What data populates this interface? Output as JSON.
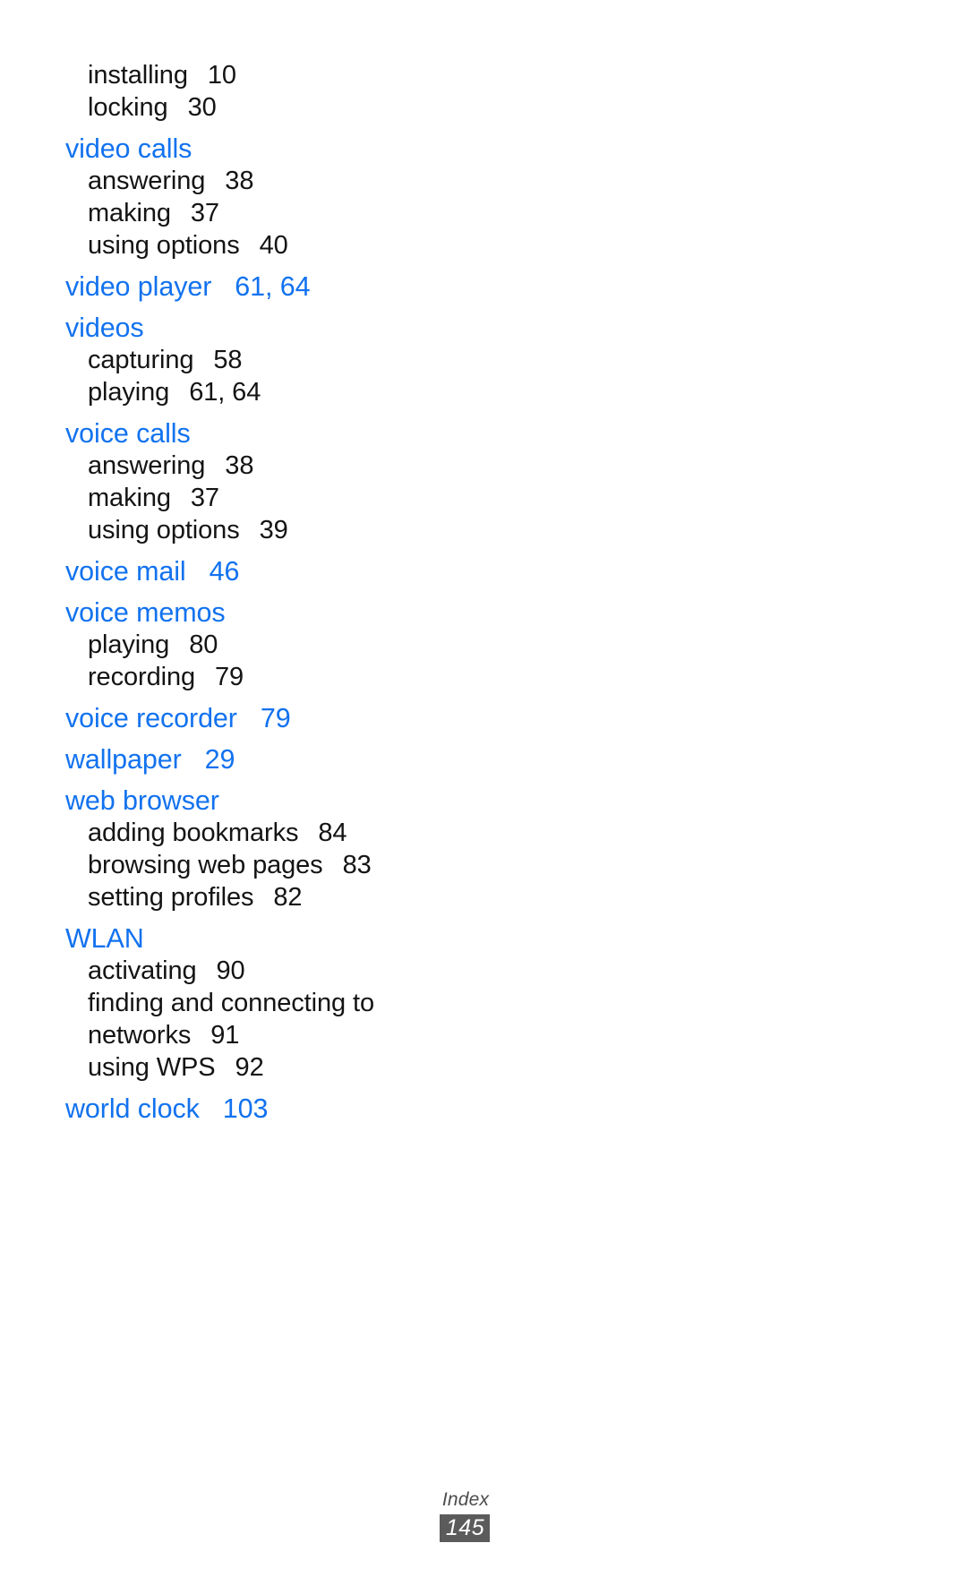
{
  "document": {
    "section_title": "Index",
    "page_number": "145",
    "heading_color": "#1272ef",
    "body_color": "#141414",
    "badge_background": "#5b5b5b",
    "badge_text_color": "#ffffff",
    "footer_label_color": "#4c4c4c"
  },
  "index": {
    "groups": [
      {
        "heading": null,
        "subentries": [
          {
            "term": "installing",
            "pages": "10"
          },
          {
            "term": "locking",
            "pages": "30"
          }
        ]
      },
      {
        "heading": {
          "term": "video calls",
          "pages": ""
        },
        "subentries": [
          {
            "term": "answering",
            "pages": "38"
          },
          {
            "term": "making",
            "pages": "37"
          },
          {
            "term": "using options",
            "pages": "40"
          }
        ]
      },
      {
        "heading": {
          "term": "video player",
          "pages": "61, 64"
        },
        "subentries": []
      },
      {
        "heading": {
          "term": "videos",
          "pages": ""
        },
        "subentries": [
          {
            "term": "capturing",
            "pages": "58"
          },
          {
            "term": "playing",
            "pages": "61, 64"
          }
        ]
      },
      {
        "heading": {
          "term": "voice calls",
          "pages": ""
        },
        "subentries": [
          {
            "term": "answering",
            "pages": "38"
          },
          {
            "term": "making",
            "pages": "37"
          },
          {
            "term": "using options",
            "pages": "39"
          }
        ]
      },
      {
        "heading": {
          "term": "voice mail",
          "pages": "46"
        },
        "subentries": []
      },
      {
        "heading": {
          "term": "voice memos",
          "pages": ""
        },
        "subentries": [
          {
            "term": "playing",
            "pages": "80"
          },
          {
            "term": "recording",
            "pages": "79"
          }
        ]
      },
      {
        "heading": {
          "term": "voice recorder",
          "pages": "79"
        },
        "subentries": []
      },
      {
        "heading": {
          "term": "wallpaper",
          "pages": "29"
        },
        "subentries": []
      },
      {
        "heading": {
          "term": "web browser",
          "pages": ""
        },
        "subentries": [
          {
            "term": "adding bookmarks",
            "pages": "84"
          },
          {
            "term": "browsing web pages",
            "pages": "83"
          },
          {
            "term": "setting profiles",
            "pages": "82"
          }
        ]
      },
      {
        "heading": {
          "term": "WLAN",
          "pages": ""
        },
        "subentries": [
          {
            "term": "activating",
            "pages": "90"
          },
          {
            "term": "finding and connecting to networks",
            "pages": "91",
            "wrap": true
          },
          {
            "term": "using WPS",
            "pages": "92"
          }
        ]
      },
      {
        "heading": {
          "term": "world clock",
          "pages": "103"
        },
        "subentries": []
      }
    ]
  }
}
